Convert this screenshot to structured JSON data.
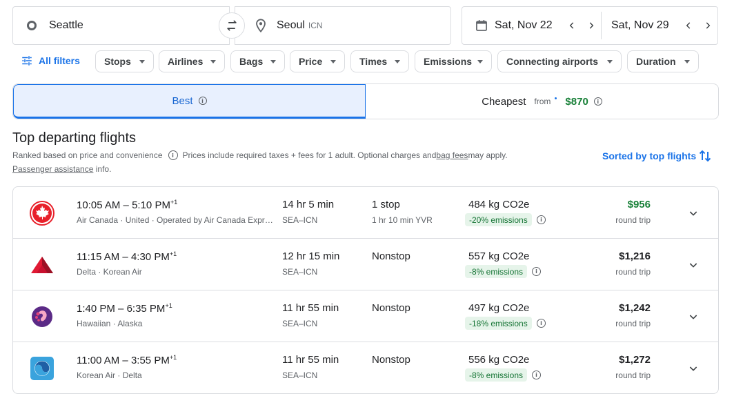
{
  "search": {
    "origin": "Seattle",
    "destination": "Seoul",
    "destination_code": "ICN",
    "depart_date": "Sat, Nov 22",
    "return_date": "Sat, Nov 29"
  },
  "filters": {
    "all_filters_label": "All filters",
    "chips": [
      "Stops",
      "Airlines",
      "Bags",
      "Price",
      "Times",
      "Emissions",
      "Connecting airports",
      "Duration"
    ]
  },
  "tabs": {
    "best_label": "Best",
    "cheapest_label": "Cheapest",
    "cheapest_from": "from",
    "cheapest_price": "$870"
  },
  "results": {
    "title": "Top departing flights",
    "ranking_note": "Ranked based on price and convenience",
    "prices_note": "Prices include required taxes + fees for 1 adult. Optional charges and ",
    "bag_fees_link": "bag fees",
    "prices_note_end": " may apply.",
    "assistance_link": "Passenger assistance",
    "assistance_end": " info.",
    "sort_label": "Sorted by top flights"
  },
  "flights": [
    {
      "logo": "air-canada-maple-leaf",
      "depart": "10:05 AM",
      "arrive": "5:10 PM",
      "day_offset": "+1",
      "airlines": "Air Canada · United · Operated by Air Canada Express - Jazz",
      "duration": "14 hr 5 min",
      "route": "SEA–ICN",
      "stops": "1 stop",
      "layover": "1 hr 10 min YVR",
      "co2": "484 kg CO2e",
      "emissions": "-20% emissions",
      "price": "$956",
      "price_color": "#188038",
      "trip_type": "round trip"
    },
    {
      "logo": "delta-widget",
      "depart": "11:15 AM",
      "arrive": "4:30 PM",
      "day_offset": "+1",
      "airlines": "Delta · Korean Air",
      "duration": "12 hr 15 min",
      "route": "SEA–ICN",
      "stops": "Nonstop",
      "layover": "",
      "co2": "557 kg CO2e",
      "emissions": "-8% emissions",
      "price": "$1,216",
      "price_color": "#202124",
      "trip_type": "round trip"
    },
    {
      "logo": "hawaiian-pualani",
      "depart": "1:40 PM",
      "arrive": "6:35 PM",
      "day_offset": "+1",
      "airlines": "Hawaiian · Alaska",
      "duration": "11 hr 55 min",
      "route": "SEA–ICN",
      "stops": "Nonstop",
      "layover": "",
      "co2": "497 kg CO2e",
      "emissions": "-18% emissions",
      "price": "$1,242",
      "price_color": "#202124",
      "trip_type": "round trip"
    },
    {
      "logo": "korean-air-taeguk",
      "depart": "11:00 AM",
      "arrive": "3:55 PM",
      "day_offset": "+1",
      "airlines": "Korean Air · Delta",
      "duration": "11 hr 55 min",
      "route": "SEA–ICN",
      "stops": "Nonstop",
      "layover": "",
      "co2": "556 kg CO2e",
      "emissions": "-8% emissions",
      "price": "$1,272",
      "price_color": "#202124",
      "trip_type": "round trip"
    }
  ],
  "colors": {
    "accent": "#1a73e8",
    "good_price": "#188038",
    "emissions_bg": "#e6f4ea"
  }
}
